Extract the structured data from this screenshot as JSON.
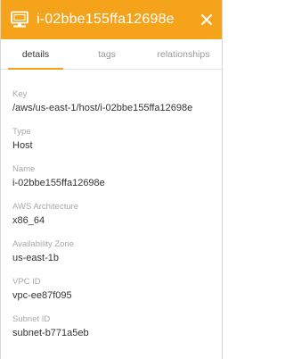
{
  "header": {
    "icon": "host-icon",
    "title": "i-02bbe155ffa12698e",
    "close_icon": "close-icon",
    "accent_color": "#f5a31b"
  },
  "tabs": [
    {
      "label": "details",
      "active": true
    },
    {
      "label": "tags",
      "active": false
    },
    {
      "label": "relationships",
      "active": false
    }
  ],
  "fields": [
    {
      "label": "Key",
      "value": "/aws/us-east-1/host/i-02bbe155ffa12698e"
    },
    {
      "label": "Type",
      "value": "Host"
    },
    {
      "label": "Name",
      "value": "i-02bbe155ffa12698e"
    },
    {
      "label": "AWS Architecture",
      "value": "x86_64"
    },
    {
      "label": "Availability Zone",
      "value": "us-east-1b"
    },
    {
      "label": "VPC ID",
      "value": "vpc-ee87f095"
    },
    {
      "label": "Subnet ID",
      "value": "subnet-b771a5eb"
    }
  ]
}
